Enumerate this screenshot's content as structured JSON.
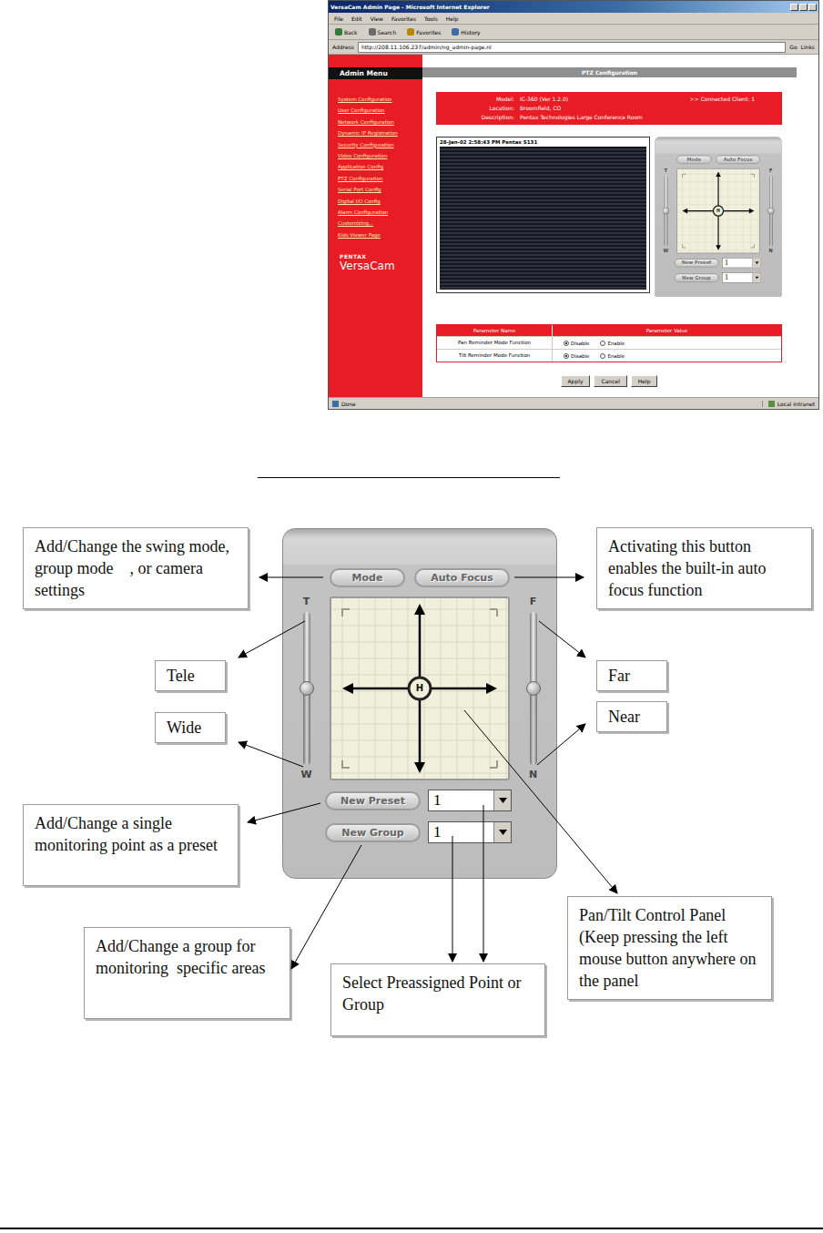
{
  "browser": {
    "title": "VersaCam Admin Page - Microsoft Internet Explorer",
    "menu": [
      "File",
      "Edit",
      "View",
      "Favorites",
      "Tools",
      "Help"
    ],
    "toolbar": [
      "Back",
      "Search",
      "Favorites",
      "History"
    ],
    "address_label": "Address",
    "address": "http://208.11.106.237/admin/ng_admin-page.nl",
    "go": "Go",
    "links": "Links",
    "status_left": "Done",
    "status_right": "Local intranet"
  },
  "sidebar": {
    "title": "Admin Menu",
    "items": [
      "System Configuration",
      "User Configuration",
      "Network Configuration",
      "Dynamic IP Registration",
      "Security Configuration",
      "Video Configuration",
      "Application Config",
      "PTZ Configuration",
      "Serial Port Config",
      "Digital I/O Config",
      "Alarm Configuration",
      "Customizing...",
      "Kids Viewer Page"
    ],
    "logo_brand": "PENTAX",
    "logo_product": "VersaCam"
  },
  "page": {
    "header": "PTZ Configuration",
    "info": [
      {
        "label": "Model:",
        "value": "IC-360 (Ver 1.2.0)"
      },
      {
        "label": "Location:",
        "value": "Broomfield, CO"
      },
      {
        "label": "Description:",
        "value": "Pentax Technologies Large Conference Room"
      }
    ],
    "client": ">> Connected Client: 1",
    "video_caption": "28-Jan-02 2:58:43 PM Pentax S131",
    "mini_panel": {
      "mode": "Mode",
      "auto_focus": "Auto Focus",
      "zoom_top": "T",
      "zoom_bottom": "W",
      "zoom_level": 0.5,
      "focus_top": "F",
      "focus_bottom": "N",
      "focus_level": 0.5,
      "center": "H",
      "preset_button": "New Preset",
      "preset_value": "1",
      "group_button": "New Group",
      "group_value": "1"
    },
    "table": {
      "columns": [
        "Parameter Name",
        "Parameter Value"
      ],
      "rows": [
        {
          "name": "Pan Reminder Mode Function",
          "options": [
            {
              "label": "Disable",
              "selected": true
            },
            {
              "label": "Enable",
              "selected": false
            }
          ]
        },
        {
          "name": "Tilt Reminder Mode Function",
          "options": [
            {
              "label": "Disable",
              "selected": true
            },
            {
              "label": "Enable",
              "selected": false
            }
          ]
        }
      ]
    },
    "buttons": [
      "Apply",
      "Cancel",
      "Help"
    ]
  },
  "diagram": {
    "panel": {
      "mode": "Mode",
      "auto_focus": "Auto Focus",
      "zoom_top": "T",
      "zoom_bottom": "W",
      "zoom_level": 0.5,
      "focus_top": "F",
      "focus_bottom": "N",
      "focus_level": 0.5,
      "center": "H",
      "preset_button": "New Preset",
      "preset_value": "1",
      "group_button": "New Group",
      "group_value": "1"
    },
    "callouts": [
      {
        "text": "Add/Change the swing mode, group mode    , or camera settings"
      },
      {
        "text": "Activating this button enables the built-in auto focus function"
      },
      {
        "text": "Tele"
      },
      {
        "text": "Far"
      },
      {
        "text": "Near"
      },
      {
        "text": "Wide"
      },
      {
        "text": "Add/Change a single monitoring point as a preset"
      },
      {
        "text": "Add/Change a group for monitoring  specific areas"
      },
      {
        "text": "Select Preassigned Point or Group"
      },
      {
        "text": "Pan/Tilt Control Panel (Keep pressing the left mouse button anywhere on the panel"
      }
    ]
  }
}
